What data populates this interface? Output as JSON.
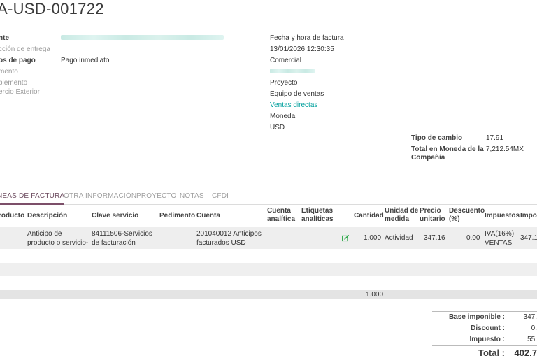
{
  "document": {
    "number": "A-USD-001722"
  },
  "fields": {
    "client_label": "nte",
    "delivery_label": "cción de entrega",
    "payment_terms_label": "os de pago",
    "payment_terms_value": "Pago inmediato",
    "document_label": "mento",
    "complement_label_1": "plemento",
    "complement_label_2": "ercio Exterior",
    "invoice_datetime_label": "Fecha y hora de factura",
    "invoice_datetime_value": "13/01/2026 12:30:35",
    "salesperson_label": "Comercial",
    "project_label": "Proyecto",
    "sales_team_label": "Equipo de ventas",
    "sales_team_value": "Ventas directas",
    "currency_label": "Moneda",
    "currency_value": "USD",
    "exchange_rate_label": "Tipo de cambio",
    "exchange_rate_value": "17.91",
    "company_total_label_1": "Total en Moneda de la",
    "company_total_label_2": "Compañía",
    "company_total_value": "7,212.54MX"
  },
  "tabs": [
    {
      "label": "NEAS DE FACTURA",
      "active": true
    },
    {
      "label": "OTRA INFORMACIÓN",
      "active": false
    },
    {
      "label": "PROYECTO",
      "active": false
    },
    {
      "label": "NOTAS",
      "active": false
    },
    {
      "label": "CFDI",
      "active": false
    }
  ],
  "table": {
    "headers": {
      "producto": "roducto",
      "descripcion": "Descripción",
      "clave": "Clave servicio",
      "pedimento": "Pedimento",
      "cuenta": "Cuenta",
      "cuenta_analitica_1": "Cuenta",
      "cuenta_analitica_2": "analítica",
      "etiquetas_1": "Etiquetas",
      "etiquetas_2": "analíticas",
      "cantidad": "Cantidad",
      "unidad_1": "Unidad de",
      "unidad_2": "medida",
      "precio_1": "Precio",
      "precio_2": "unitario",
      "descuento_1": "Descuento",
      "descuento_2": "(%)",
      "impuestos": "Impuestos",
      "importe": "Impor"
    },
    "row": {
      "descripcion_1": "Anticipo de",
      "descripcion_2": "producto o servicio-",
      "clave_1": "84111506-Servicios",
      "clave_2": "de facturación",
      "cuenta_1": "201040012 Anticipos",
      "cuenta_2": "facturados USD",
      "cantidad": "1.000",
      "unidad": "Actividad",
      "precio": "347.16",
      "descuento": "0.00",
      "impuestos_1": "IVA(16%)",
      "impuestos_2": "VENTAS",
      "importe": "347.1"
    },
    "footer_quantity": "1.000"
  },
  "totals": {
    "base_label": "Base imponible :",
    "base_value": "347.",
    "discount_label": "Discount :",
    "discount_value": "0.",
    "tax_label": "Impuesto :",
    "tax_value": "55.",
    "total_label": "Total :",
    "total_value": "402.7"
  },
  "colors": {
    "accent": "#00a09d",
    "tab_active": "#7c4f69"
  },
  "icons": {
    "edit": "edit-icon"
  }
}
